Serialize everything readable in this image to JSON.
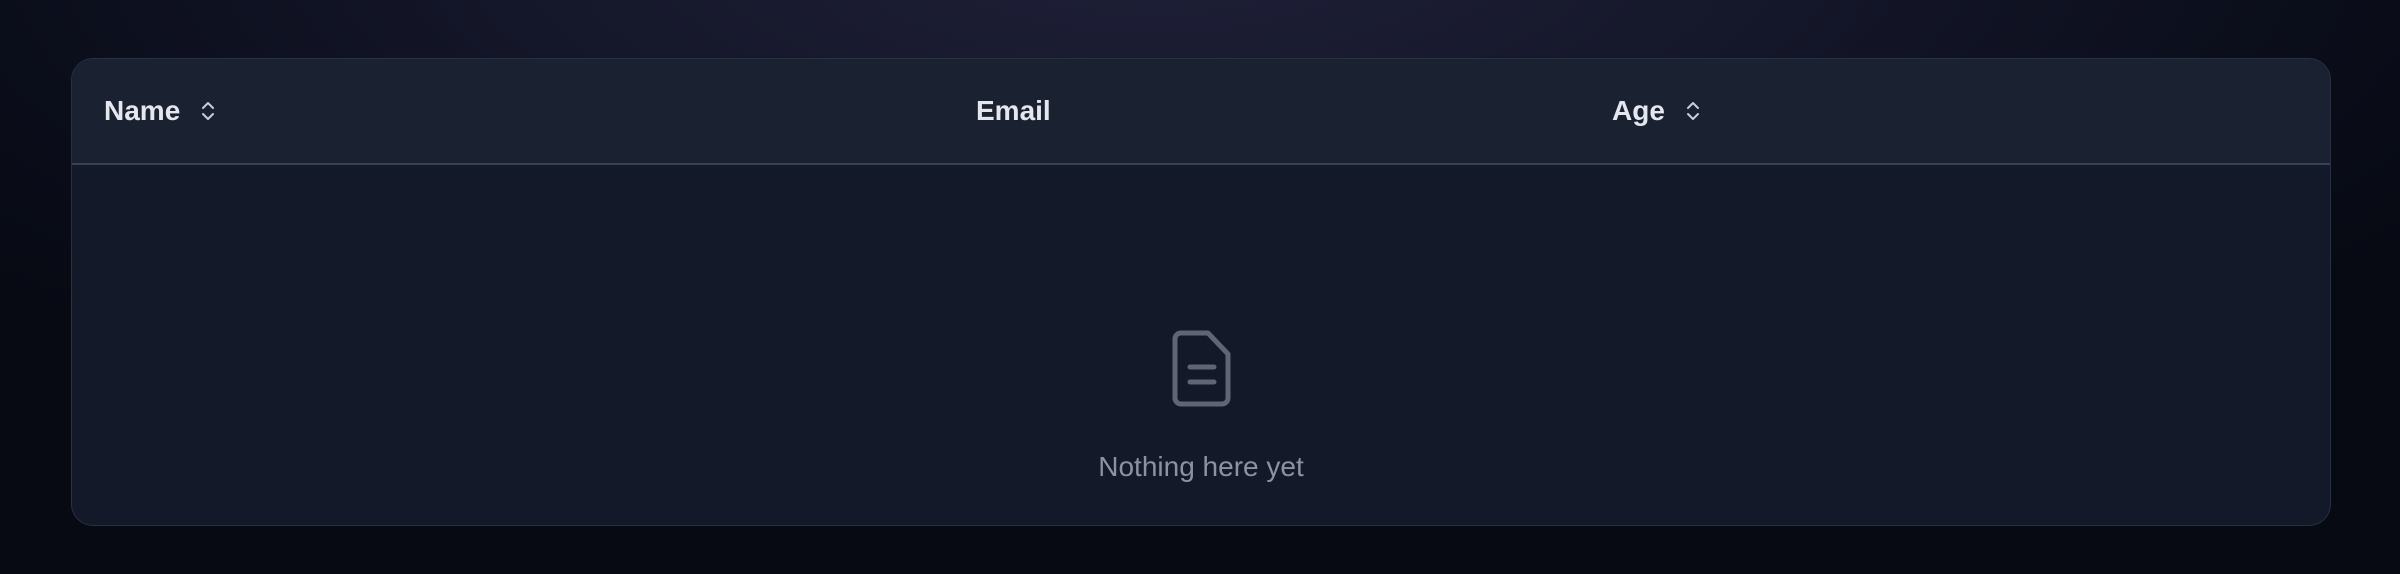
{
  "table": {
    "columns": [
      {
        "label": "Name",
        "sortable": true
      },
      {
        "label": "Email",
        "sortable": false
      },
      {
        "label": "Age",
        "sortable": true
      }
    ],
    "rows": [],
    "empty_state": {
      "icon": "file-document-icon",
      "message": "Nothing here yet"
    }
  },
  "colors": {
    "page_background": "#0b0e1b",
    "card_background": "#131929",
    "header_background": "#1a2131",
    "header_text": "#e4e7ee",
    "muted_text": "#8a92a4",
    "icon_gray": "#5d6577"
  }
}
